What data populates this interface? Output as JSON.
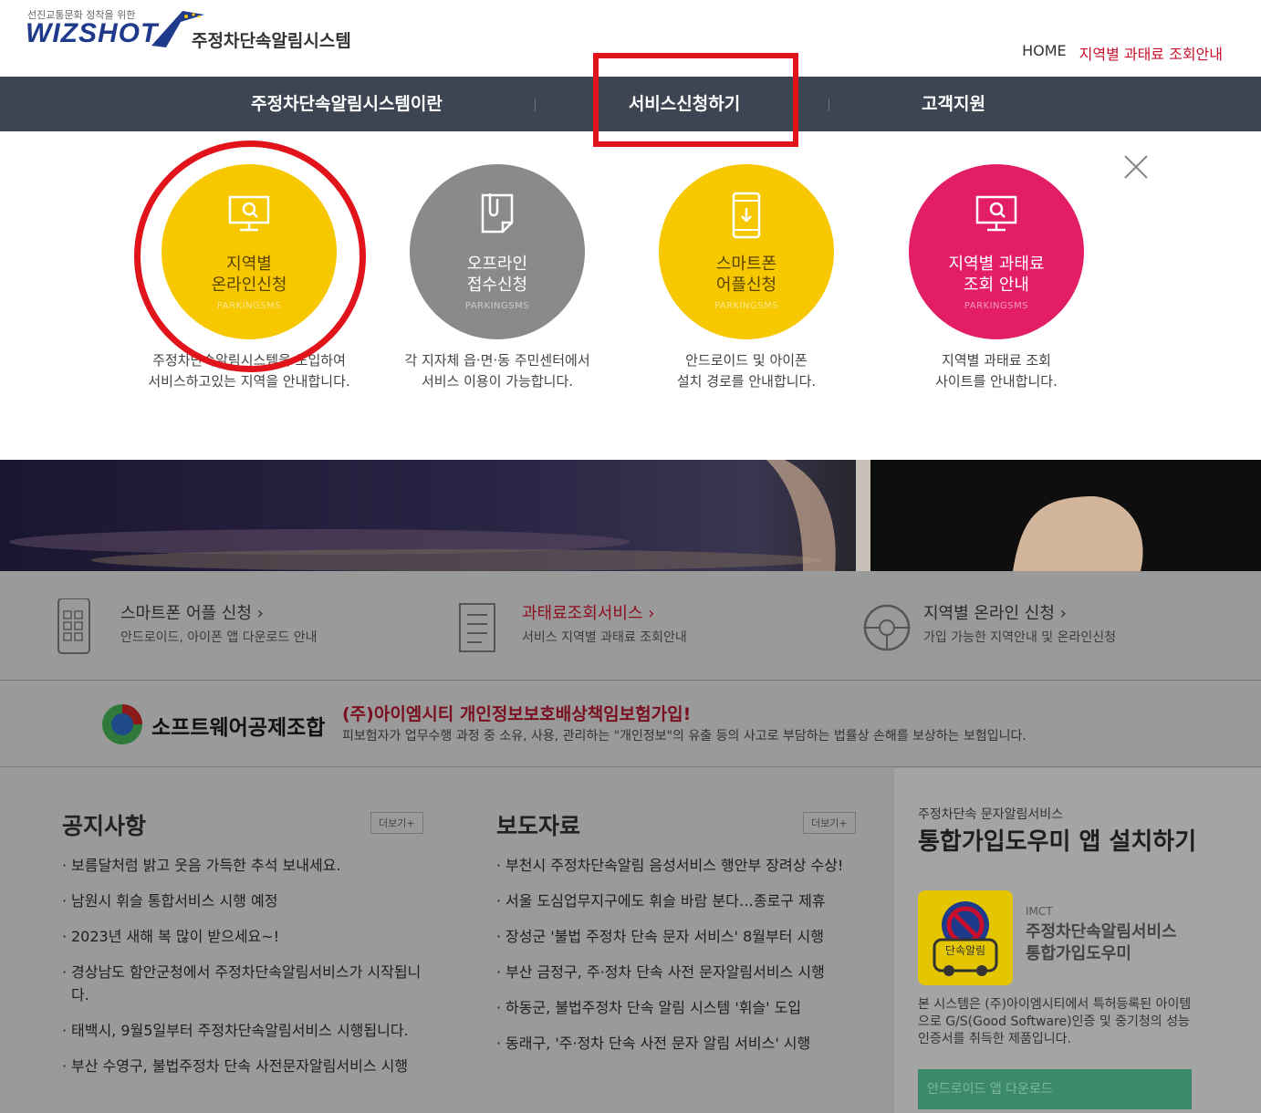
{
  "header": {
    "logo_tag": "선진교통문화 정착을 위한",
    "logo_brand": "WIZSHOT",
    "logo_name": "주정차단속알림시스템",
    "home_link": "HOME",
    "region_link": "지역별 과태료 조회안내"
  },
  "nav": {
    "items": [
      {
        "label": "주정차단속알림시스템이란"
      },
      {
        "label": "서비스신청하기"
      },
      {
        "label": "고객지원"
      }
    ]
  },
  "services": [
    {
      "title1": "지역별",
      "title2": "온라인신청",
      "sub": "PARKINGSMS",
      "desc1": "주정차단속알림시스템을 도입하여",
      "desc2": "서비스하고있는 지역을 안내합니다.",
      "color": "#f7c700"
    },
    {
      "title1": "오프라인",
      "title2": "접수신청",
      "sub": "PARKINGSMS",
      "desc1": "각 지자체 읍·면·동 주민센터에서",
      "desc2": "서비스 이용이 가능합니다.",
      "color": "#8a8a8a"
    },
    {
      "title1": "스마트폰",
      "title2": "어플신청",
      "sub": "PARKINGSMS",
      "desc1": "안드로이드 및 아이폰",
      "desc2": "설치 경로를 안내합니다.",
      "color": "#f7c700"
    },
    {
      "title1": "지역별 과태료",
      "title2": "조회 안내",
      "sub": "PARKINGSMS",
      "desc1": "지역별 과태료 조회",
      "desc2": "사이트를 안내합니다.",
      "color": "#e31d66"
    }
  ],
  "quick_links": [
    {
      "title": "스마트폰 어플 신청",
      "sub": "안드로이드, 아이폰 앱 다운로드 안내"
    },
    {
      "title": "과태료조회서비스",
      "sub": "서비스 지역별 과태료 조회안내"
    },
    {
      "title": "지역별 온라인 신청",
      "sub": "가입 가능한 지역안내 및 온라인신청"
    }
  ],
  "insurance": {
    "org": "소프트웨어공제조합",
    "title": "(주)아이엠시티 개인정보보호배상책임보험가입!",
    "desc": "피보험자가 업무수행 과정 중 소유, 사용, 관리하는 \"개인정보\"의 유출 등의 사고로 부담하는 법률상 손해를 보상하는 보험입니다."
  },
  "notices": {
    "title": "공지사항",
    "more": "더보기+",
    "items": [
      "보름달처럼 밝고 웃음 가득한 추석 보내세요.",
      "남원시 휘슬 통합서비스 시행 예정",
      "2023년 새해 복 많이 받으세요~!",
      "경상남도 함안군청에서 주정차단속알림서비스가 시작됩니다.",
      "태백시, 9월5일부터 주정차단속알림서비스 시행됩니다.",
      "부산 수영구, 불법주정차 단속 사전문자알림서비스 시행"
    ]
  },
  "press": {
    "title": "보도자료",
    "more": "더보기+",
    "items": [
      "부천시 주정차단속알림 음성서비스 행안부 장려상 수상!",
      "서울 도심업무지구에도 휘슬 바람 분다…종로구 제휴",
      "장성군 '불법 주정차 단속 문자 서비스' 8월부터 시행",
      "부산 금정구, 주·정차 단속 사전 문자알림서비스 시행",
      "하동군, 불법주정차 단속 알림 시스템 '휘슬' 도입",
      "동래구, '주·정차 단속 사전 문자 알림 서비스' 시행"
    ]
  },
  "app_promo": {
    "small": "주정차단속 문자알림서비스",
    "title": "통합가입도우미 앱 설치하기",
    "icon_label": "단속알림",
    "company": "IMCT",
    "name1": "주정차단속알림서비스",
    "name2": "통합가입도우미",
    "desc": "본 시스템은 (주)아이엠시티에서 특허등록된 아이템으로 G/S(Good Software)인증 및 중기청의 성능인증서를 취득한 제품입니다.",
    "download": "안드로이드 앱 다운로드"
  },
  "colors": {
    "nav_bg": "#3d4553",
    "annotation": "#e1141c",
    "accent_red": "#c8102e"
  }
}
